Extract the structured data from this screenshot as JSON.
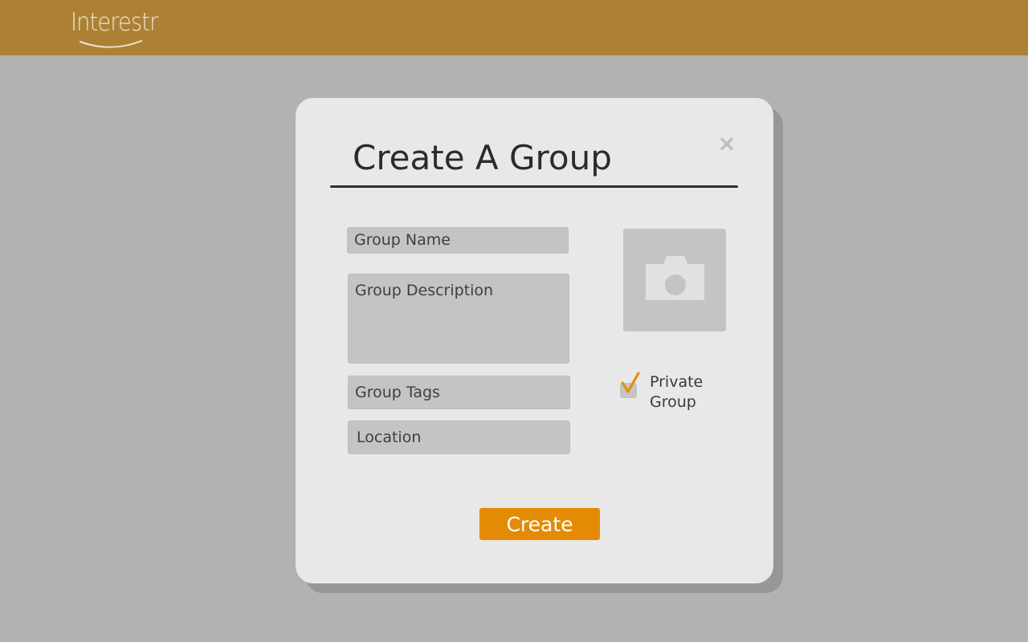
{
  "header": {
    "logo_text": "Interestr",
    "background_color": "#ad8135"
  },
  "modal": {
    "title": "Create A Group",
    "close_icon": "x-close-icon",
    "fields": {
      "group_name_placeholder": "Group Name",
      "group_description_placeholder": "Group Description",
      "group_tags_placeholder": "Group Tags",
      "location_placeholder": "Location"
    },
    "photo_icon": "camera-icon",
    "private_group": {
      "label": "Private Group",
      "checked": true
    },
    "create_button_label": "Create",
    "accent_color": "#e48b06"
  }
}
